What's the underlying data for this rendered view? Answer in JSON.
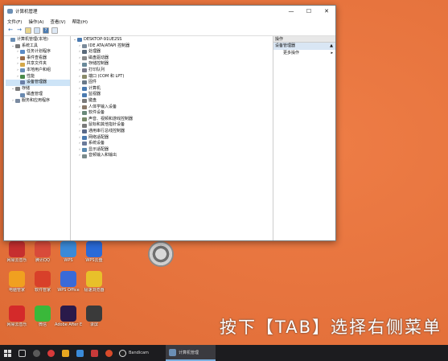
{
  "window": {
    "title": "计算机管理",
    "controls": [
      "—",
      "☐",
      "✕"
    ],
    "menu": [
      "文件(F)",
      "操作(A)",
      "查看(V)",
      "帮助(H)"
    ],
    "toolbar_icons": [
      "back-icon",
      "forward-icon",
      "up-folder-icon",
      "properties-icon",
      "help-icon",
      "view-icon"
    ]
  },
  "left_tree": [
    {
      "label": "计算机管理(本地)",
      "indent": 0,
      "exp": "",
      "color": "#6b8fb5"
    },
    {
      "label": "系统工具",
      "indent": 1,
      "exp": "⌄",
      "color": "#7a7a7a"
    },
    {
      "label": "任务计划程序",
      "indent": 2,
      "exp": "›",
      "color": "#5a8ac6"
    },
    {
      "label": "事件查看器",
      "indent": 2,
      "exp": "›",
      "color": "#9a6b4a"
    },
    {
      "label": "共享文件夹",
      "indent": 2,
      "exp": "›",
      "color": "#d4a84a"
    },
    {
      "label": "本地用户和组",
      "indent": 2,
      "exp": "›",
      "color": "#6a8fb8"
    },
    {
      "label": "性能",
      "indent": 2,
      "exp": "›",
      "color": "#4a8a4a"
    },
    {
      "label": "设备管理器",
      "indent": 2,
      "exp": "",
      "color": "#6a7fa8",
      "selected": true
    },
    {
      "label": "存储",
      "indent": 1,
      "exp": "⌄",
      "color": "#7a7a7a"
    },
    {
      "label": "磁盘管理",
      "indent": 2,
      "exp": "",
      "color": "#6a8ab0"
    },
    {
      "label": "服务和应用程序",
      "indent": 1,
      "exp": "›",
      "color": "#7a8aa0"
    }
  ],
  "device_tree": {
    "root": "DESKTOP-91UE2SS",
    "items": [
      {
        "label": "IDE ATA/ATAPI 控制器",
        "color": "#7a8a9a"
      },
      {
        "label": "处理器",
        "color": "#5a6a7a"
      },
      {
        "label": "磁盘驱动器",
        "color": "#8a8a8a"
      },
      {
        "label": "存储控制器",
        "color": "#6a8a9a"
      },
      {
        "label": "打印队列",
        "color": "#7a7a8a"
      },
      {
        "label": "端口 (COM 和 LPT)",
        "color": "#8a8a6a"
      },
      {
        "label": "固件",
        "color": "#6a7a8a"
      },
      {
        "label": "计算机",
        "color": "#4a7ab0"
      },
      {
        "label": "监视器",
        "color": "#4a7ab0"
      },
      {
        "label": "键盘",
        "color": "#7a7a7a"
      },
      {
        "label": "人体学输入设备",
        "color": "#8a7a6a"
      },
      {
        "label": "软件设备",
        "color": "#6a8a7a"
      },
      {
        "label": "声音、视频和游戏控制器",
        "color": "#7a8a6a"
      },
      {
        "label": "鼠标和其他指针设备",
        "color": "#7a7a7a"
      },
      {
        "label": "通用串行总线控制器",
        "color": "#5a6a8a"
      },
      {
        "label": "网络适配器",
        "color": "#4a7ab0"
      },
      {
        "label": "系统设备",
        "color": "#6a7a9a"
      },
      {
        "label": "显示适配器",
        "color": "#5a8ab0"
      },
      {
        "label": "音频输入和输出",
        "color": "#7a8a8a"
      }
    ]
  },
  "actions": {
    "header": "操作",
    "section": "设备管理器",
    "more": "更多操作"
  },
  "desktop_icons": [
    {
      "label": "网易云音乐",
      "color": "#c62f2f"
    },
    {
      "label": "腾讯QQ",
      "color": "#d84a3a"
    },
    {
      "label": "WPS",
      "color": "#3a8ad8"
    },
    {
      "label": "WPS云盘",
      "color": "#2a6ad8"
    },
    {
      "label": "电脑管家",
      "color": "#f0a020"
    },
    {
      "label": "软件管家",
      "color": "#d8402a"
    },
    {
      "label": "WPS Office",
      "color": "#3a6ad8"
    },
    {
      "label": "极速浏览器",
      "color": "#e8c02a"
    },
    {
      "label": "网易云音乐",
      "color": "#d42a2a"
    },
    {
      "label": "微信",
      "color": "#3ab83a"
    },
    {
      "label": "Adobe After Effects 2020",
      "color": "#2a1a4a"
    },
    {
      "label": "录屏",
      "color": "#3a3a3a"
    }
  ],
  "subtitle": "按下【TAB】选择右侧菜单",
  "taskbar": {
    "apps": [
      {
        "name": "start-icon",
        "label": ""
      },
      {
        "name": "task-view-icon",
        "label": ""
      },
      {
        "name": "taskbar-app-icon",
        "label": ""
      },
      {
        "name": "taskbar-app-icon",
        "label": ""
      },
      {
        "name": "taskbar-app-icon",
        "label": ""
      },
      {
        "name": "taskbar-app-icon",
        "label": ""
      },
      {
        "name": "taskbar-app-icon",
        "label": ""
      },
      {
        "name": "taskbar-app-icon",
        "label": ""
      }
    ],
    "bandicam": "Bandicam",
    "computer_mgmt": "计算机管理"
  }
}
